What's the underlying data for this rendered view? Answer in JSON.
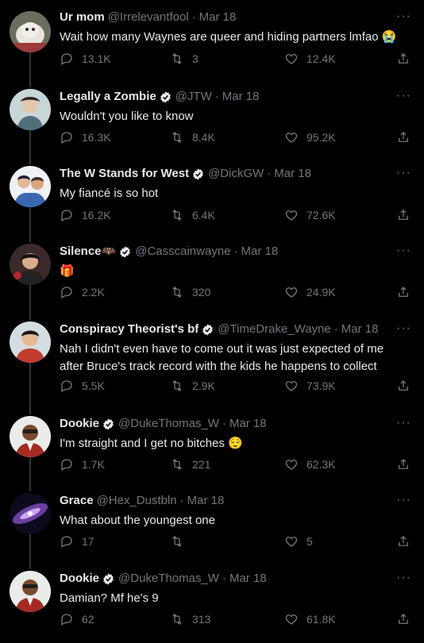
{
  "tweets": [
    {
      "name": "Ur mom",
      "handle": "@Irrelevantfool",
      "dot": "·",
      "date": "Mar 18",
      "verified": false,
      "text": "Wait how many Waynes are queer and hiding partners lmfao 😭",
      "replies": "13.1K",
      "retweets": "3",
      "likes": "12.4K"
    },
    {
      "name": "Legally a Zombie",
      "handle": "@JTW",
      "dot": "·",
      "date": "Mar 18",
      "verified": true,
      "text": "Wouldn't you like to know",
      "replies": "16.3K",
      "retweets": "8.4K",
      "likes": "95.2K"
    },
    {
      "name": "The W Stands for West",
      "handle": "@DickGW",
      "dot": "·",
      "date": "Mar 18",
      "verified": true,
      "text": "My fiancé is so hot",
      "replies": "16.2K",
      "retweets": "6.4K",
      "likes": "72.6K"
    },
    {
      "name": "Silence🦇",
      "handle": "@Casscainwayne",
      "dot": "·",
      "date": "Mar 18",
      "verified": true,
      "text": "🎁",
      "replies": "2.2K",
      "retweets": "320",
      "likes": "24.9K"
    },
    {
      "name": "Conspiracy Theorist's bf",
      "handle": "@TimeDrake_Wayne",
      "dot": "·",
      "date": "Mar 18",
      "verified": true,
      "text": "Nah I didn't even have to come out it was just expected of me after Bruce's track record with the kids he happens to collect",
      "replies": "5.5K",
      "retweets": "2.9K",
      "likes": "73.9K"
    },
    {
      "name": "Dookie",
      "handle": "@DukeThomas_W",
      "dot": "·",
      "date": "Mar 18",
      "verified": true,
      "text": "I'm straight and I get no bitches 😌",
      "replies": "1.7K",
      "retweets": "221",
      "likes": "62.3K"
    },
    {
      "name": "Grace",
      "handle": "@Hex_Dustbln",
      "dot": "·",
      "date": "Mar 18",
      "verified": false,
      "text": "What about the youngest one",
      "replies": "17",
      "retweets": "",
      "likes": "5"
    },
    {
      "name": "Dookie",
      "handle": "@DukeThomas_W",
      "dot": "·",
      "date": "Mar 18",
      "verified": true,
      "text": "Damian? Mf he's 9",
      "replies": "62",
      "retweets": "313",
      "likes": "61.8K"
    }
  ],
  "more_icon": "···",
  "colors": {
    "background": "#000000",
    "text": "#e7e9ea",
    "muted": "#71767b",
    "verified": "#e7e9ea"
  }
}
